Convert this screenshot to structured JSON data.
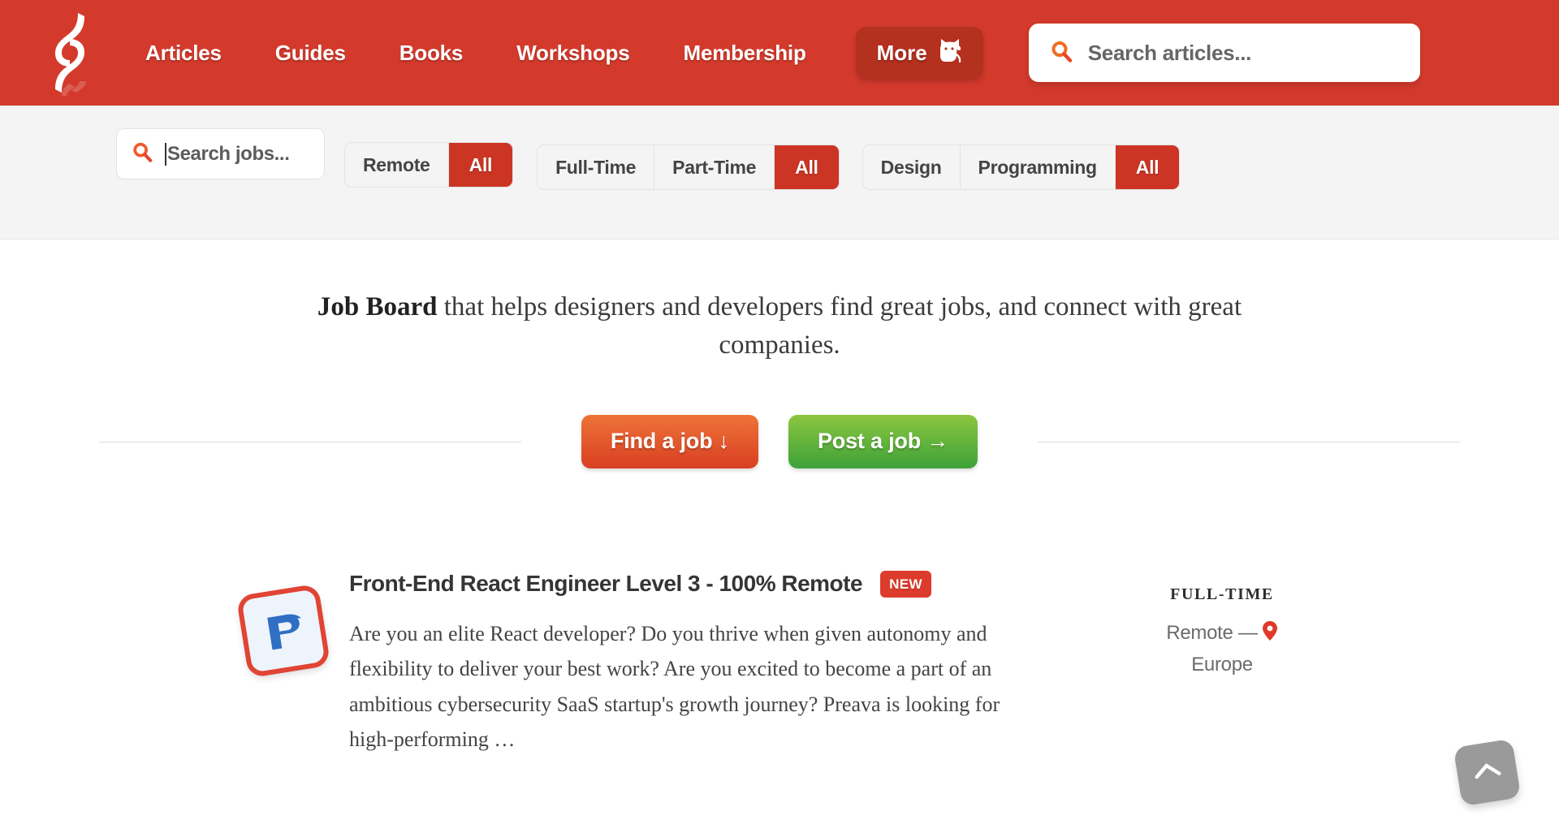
{
  "header": {
    "logo_name": "smashing-magazine-logo",
    "nav": [
      {
        "label": "Articles"
      },
      {
        "label": "Guides"
      },
      {
        "label": "Books"
      },
      {
        "label": "Workshops"
      },
      {
        "label": "Membership"
      }
    ],
    "more_button": {
      "label": "More",
      "icon": "cat-icon"
    },
    "search": {
      "icon": "search-icon",
      "placeholder": "Search articles...",
      "value": ""
    },
    "bg_color": "#d33a2c",
    "more_bg_color": "#b4301f"
  },
  "filter_bar": {
    "search": {
      "icon": "search-icon",
      "placeholder": "Search jobs...",
      "value": ""
    },
    "groups": [
      {
        "name": "location",
        "options": [
          {
            "label": "Remote",
            "active": false
          },
          {
            "label": "All",
            "active": true
          }
        ]
      },
      {
        "name": "commitment",
        "options": [
          {
            "label": "Full-Time",
            "active": false
          },
          {
            "label": "Part-Time",
            "active": false
          },
          {
            "label": "All",
            "active": true
          }
        ]
      },
      {
        "name": "category",
        "options": [
          {
            "label": "Design",
            "active": false
          },
          {
            "label": "Programming",
            "active": false
          },
          {
            "label": "All",
            "active": true
          }
        ]
      }
    ],
    "active_color": "#cc3524",
    "bg_color": "#f4f4f4"
  },
  "intro": {
    "lead": "Job Board",
    "rest": " that helps designers and developers find great jobs, and connect with great companies."
  },
  "cta": {
    "find": {
      "label": "Find a job ↓",
      "color_from": "#ee7338",
      "color_to": "#d93f22"
    },
    "post": {
      "label": "Post a job →",
      "color_from": "#8cc63f",
      "color_to": "#3da239"
    }
  },
  "jobs": [
    {
      "logo_name": "preava-logo",
      "title": "Front-End React Engineer Level 3 - 100% Remote",
      "badge": "NEW",
      "description": "Are you an elite React developer? Do you thrive when given autonomy and flexibility to deliver your best work? Are you excited to become a part of an ambitious cybersecurity SaaS startup's growth journey? Preava is looking for high-performing …",
      "commitment": "FULL-TIME",
      "location": "Remote —",
      "location_detail": "Europe",
      "pin_icon": "map-pin-icon"
    }
  ],
  "back_to_top": {
    "icon": "chevron-up-icon",
    "color": "#9a9a9a"
  }
}
